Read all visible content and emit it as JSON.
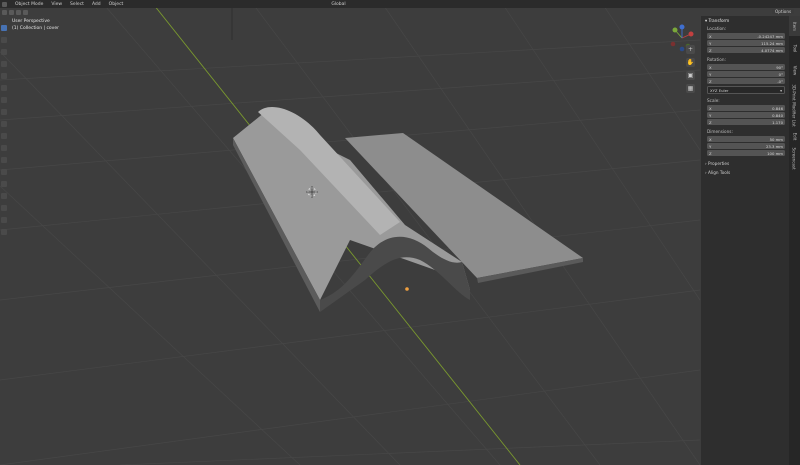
{
  "header": {
    "mode": "Object Mode",
    "menus": [
      "View",
      "Select",
      "Add",
      "Object"
    ],
    "orientation": "Global",
    "options_label": "Options"
  },
  "viewport": {
    "perspective": "User Perspective",
    "collection": "(1) Collection | cover"
  },
  "side_panel": {
    "transform_title": "Transform",
    "location": {
      "label": "Location:",
      "x": "-0.24247 mm",
      "y": "115.24 mm",
      "z": "4.0774 mm"
    },
    "rotation": {
      "label": "Rotation:",
      "x": "90°",
      "y": "0°",
      "z": "-0°",
      "mode": "XYZ Euler"
    },
    "scale": {
      "label": "Scale:",
      "x": "0.846",
      "y": "0.840",
      "z": "1.170"
    },
    "dimensions": {
      "label": "Dimensions:",
      "x": "50 mm",
      "y": "23.3 mm",
      "z": "100 mm"
    },
    "properties": "Properties",
    "align_tools": "Align Tools"
  },
  "tabs": [
    "Item",
    "Tool",
    "View",
    "3D-Print",
    "Modifier List",
    "Edit",
    "Screencast"
  ],
  "colors": {
    "background": "#3d3d3d",
    "grid": "#474747",
    "x_axis": "#8b3a3a",
    "y_axis": "#7a9a2e",
    "model": "#8c8c8c",
    "accent": "#4772b3"
  }
}
